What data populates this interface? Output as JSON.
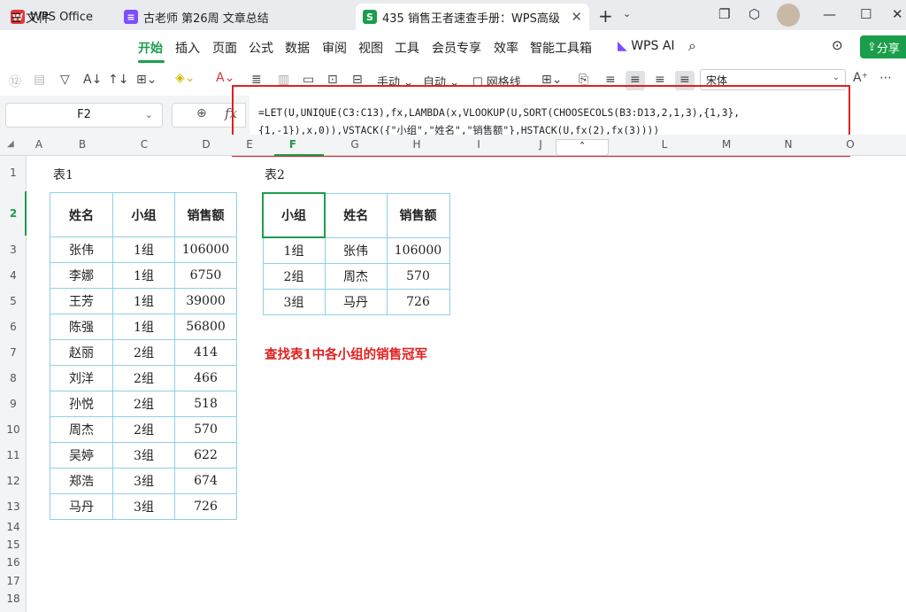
{
  "tabs": [
    {
      "logo": "W",
      "title": "WPS Office",
      "color": "#e53935"
    },
    {
      "logo": "≡",
      "title": "古老师 第26周 文章总结",
      "color": "#7c4dff"
    },
    {
      "logo": "S",
      "title": "435 销售王者速查手册：WPS高级",
      "color": "#1b9e4b"
    }
  ],
  "menu": {
    "file": "文件",
    "items": [
      "开始",
      "插入",
      "页面",
      "公式",
      "数据",
      "审阅",
      "视图",
      "工具",
      "会员专享",
      "效率",
      "智能工具箱",
      "WPS AI"
    ],
    "share": "分享"
  },
  "toolbar": {
    "manual": "手动",
    "auto": "自动",
    "gridlines": "网格线",
    "font": "宋体"
  },
  "formula_bar": {
    "cell_ref": "F2",
    "fx": "fx",
    "formula": "=LET(U,UNIQUE(C3:C13),fx,LAMBDA(x,VLOOKUP(U,SORT(CHOOSECOLS(B3:D13,2,1,3),{1,3},\n{1,-1}),x,0)),VSTACK({\"小组\",\"姓名\",\"销售额\"},HSTACK(U,fx(2),fx(3))))"
  },
  "columns": [
    "A",
    "B",
    "C",
    "D",
    "E",
    "F",
    "G",
    "H",
    "I",
    "J",
    "K",
    "L",
    "M",
    "N",
    "O"
  ],
  "rows": [
    "1",
    "2",
    "3",
    "4",
    "5",
    "6",
    "7",
    "8",
    "9",
    "10",
    "11",
    "12",
    "13",
    "14",
    "15",
    "16",
    "17",
    "18"
  ],
  "sheet": {
    "table1_caption": "表1",
    "table2_caption": "表2",
    "table1": {
      "headers": [
        "姓名",
        "小组",
        "销售额"
      ],
      "rows": [
        [
          "张伟",
          "1组",
          "106000"
        ],
        [
          "李娜",
          "1组",
          "6750"
        ],
        [
          "王芳",
          "1组",
          "39000"
        ],
        [
          "陈强",
          "1组",
          "56800"
        ],
        [
          "赵丽",
          "2组",
          "414"
        ],
        [
          "刘洋",
          "2组",
          "466"
        ],
        [
          "孙悦",
          "2组",
          "518"
        ],
        [
          "周杰",
          "2组",
          "570"
        ],
        [
          "吴婷",
          "3组",
          "622"
        ],
        [
          "郑浩",
          "3组",
          "674"
        ],
        [
          "马丹",
          "3组",
          "726"
        ]
      ]
    },
    "table2": {
      "headers": [
        "小组",
        "姓名",
        "销售额"
      ],
      "rows": [
        [
          "1组",
          "张伟",
          "106000"
        ],
        [
          "2组",
          "周杰",
          "570"
        ],
        [
          "3组",
          "马丹",
          "726"
        ]
      ]
    },
    "note": "查找表1中各小组的销售冠军"
  }
}
